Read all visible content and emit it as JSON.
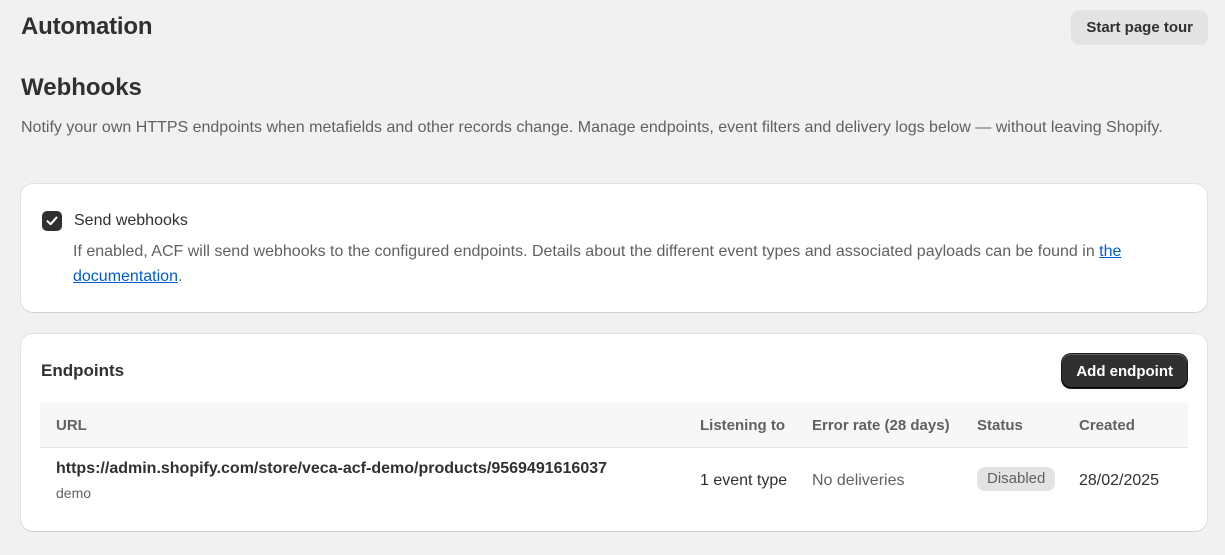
{
  "header": {
    "title": "Automation",
    "tour_button_label": "Start page tour"
  },
  "webhooks": {
    "title": "Webhooks",
    "description": "Notify your own HTTPS endpoints when metafields and other records change. Manage endpoints, event filters and delivery logs below — without leaving Shopify."
  },
  "settings": {
    "send_webhooks_label": "Send webhooks",
    "send_webhooks_checked": true,
    "help_text": "If enabled, ACF will send webhooks to the configured endpoints. Details about the different event types and associated payloads can be found in ",
    "help_link": "the documentation",
    "help_suffix": "."
  },
  "endpoints": {
    "title": "Endpoints",
    "add_button_label": "Add endpoint",
    "columns": {
      "url": "URL",
      "listening": "Listening to",
      "error_rate": "Error rate (28 days)",
      "status": "Status",
      "created": "Created"
    },
    "rows": [
      {
        "url": "https://admin.shopify.com/store/veca-acf-demo/products/9569491616037",
        "url_sub": "demo",
        "listening": "1 event type",
        "error_rate": "No deliveries",
        "status": "Disabled",
        "created": "28/02/2025"
      }
    ]
  },
  "colors": {
    "background": "#f1f1f1",
    "card": "#ffffff",
    "primary_button": "#303030",
    "link": "#005bd3",
    "badge": "#e3e3e3"
  }
}
